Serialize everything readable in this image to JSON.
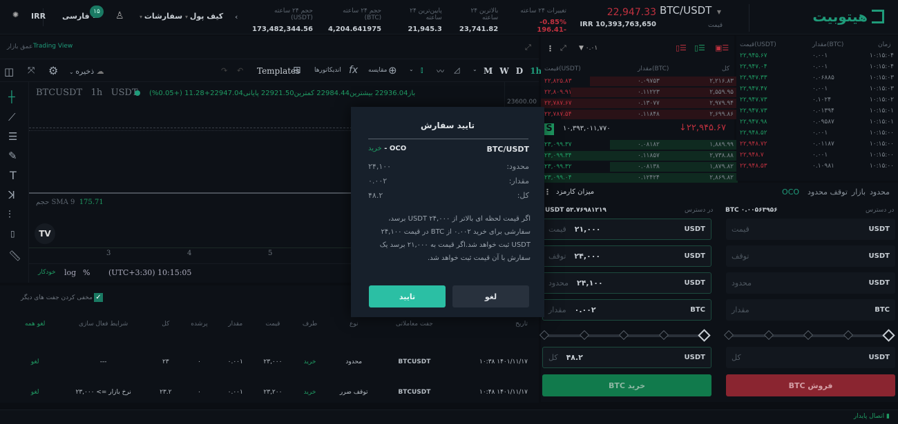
{
  "header": {
    "logo": "هیتوبیت",
    "pair": "BTC/USDT",
    "price_label": "قیمت",
    "last_price": "22,947.33",
    "irr_price": "IRR 10,393,763,650",
    "stats": [
      {
        "label": "تغییرات ۲۴ ساعته",
        "value": "-0.85%  196.41-",
        "neg": true
      },
      {
        "label": "بالاترین ۲۴ ساعته",
        "value": "23,741.82"
      },
      {
        "label": "پایین‌ترین ۲۴ ساعته",
        "value": "21,945.3"
      },
      {
        "label": "حجم ۲۴ ساعته (BTC)",
        "value": "4,204.641975"
      },
      {
        "label": "حجم ۲۴ ساعته (USDT)",
        "value": "173,482,344.56"
      }
    ],
    "wallet": "کیف پول",
    "orders": "سفارشات",
    "notif_count": "۱۵",
    "language": "فارسی",
    "currency": "IRR"
  },
  "chart": {
    "tab_depth": "عمق بازار",
    "tab_tv": "Trading View",
    "save": "ذخیره",
    "templates": "Templates",
    "indicators": "اندیکاتورها",
    "compare": "مقایسه",
    "intervals": [
      "1h",
      "D",
      "W",
      "M"
    ],
    "symbol": "BTCUSDT",
    "interval": "1h",
    "quote": "USDT",
    "ohlc": "باز22936.04  بیشترین22984.44  کمترین22921.50  پایانی22947.04+11.28 (+0.05%)",
    "price_tick": "23600.00",
    "sma_label": "حجم SMA 9",
    "sma_value": "175.71",
    "x_ticks": [
      "3",
      "4",
      "5"
    ],
    "time": "(UTC+3:30) 10:15:05",
    "pct": "%",
    "log": "log",
    "auto": "خودکار"
  },
  "open_orders": {
    "hide_others": "مخفی کردن جفت های دیگر",
    "headers": [
      "تاریخ",
      "جفت معاملاتی",
      "نوع",
      "طرف",
      "قیمت",
      "مقدار",
      "پرشده",
      "کل",
      "شرایط فعال سازی",
      "لغو همه"
    ],
    "rows": [
      [
        "۱۴۰۱/۱۱/۱۷ ۱۰:۳۸",
        "BTCUSDT",
        "محدود",
        "خرید",
        "۲۳,۰۰۰",
        "۰.۰۰۱",
        "۰",
        "۲۳",
        "---",
        "لغو"
      ],
      [
        "۱۴۰۱/۱۱/۱۷ ۱۰:۴۸",
        "BTCUSDT",
        "توقف ضرر",
        "خرید",
        "۲۳,۲۰۰",
        "۰.۰۰۱",
        "۰",
        "۲۳.۲",
        "نرخ بازار => ۲۳,۰۰۰",
        "لغو"
      ]
    ]
  },
  "orderbook": {
    "precision": "۰.۰۱",
    "headers": [
      "قیمت(USDT)",
      "مقدار(BTC)",
      "کل"
    ],
    "asks": [
      [
        "۲۲,۸۲۵.۸۳",
        "۰.۰۹۷۵۳",
        "۲,۲۱۶.۸۳"
      ],
      [
        "۲۲,۸۰۹.۹۱",
        "۰.۱۱۲۲۳",
        "۲,۵۵۹.۹۵"
      ],
      [
        "۲۲,۷۸۷.۶۷",
        "۰.۱۳۰۷۷",
        "۲,۹۷۹.۹۴"
      ],
      [
        "۲۲,۷۸۷.۵۴",
        "۰.۱۱۸۴۸",
        "۲,۶۹۹.۸۶"
      ]
    ],
    "mid_price": "↓۲۲,۹۴۵.۶۷",
    "mid_irr": "۱۰,۳۹۳,۰۱۱,۷۷۰",
    "mid_badge": "S",
    "bids": [
      [
        "۲۳,۰۹۹.۳۷",
        "۰.۰۸۱۸۲",
        "۱,۸۸۹.۹۹"
      ],
      [
        "۲۳,۰۹۹.۳۴",
        "۰.۱۱۸۵۷",
        "۲,۷۳۸.۸۸"
      ],
      [
        "۲۳,۰۹۹.۳۲",
        "۰.۰۸۱۳۸",
        "۱,۸۷۹.۸۲"
      ],
      [
        "۲۳,۰۹۹.۰۴",
        "۰.۱۲۴۲۴",
        "۲,۸۶۹.۸۲"
      ]
    ]
  },
  "trades": {
    "headers": [
      "قیمت(USDT)",
      "مقدار(BTC)",
      "زمان"
    ],
    "rows": [
      [
        "۲۲,۹۴۵.۶۷",
        "۰.۰۰۱",
        "۱۰:۱۵:۰۴",
        "g"
      ],
      [
        "۲۲,۹۴۷.۰۴",
        "۰.۰۰۱",
        "۱۰:۱۵:۰۴",
        "g"
      ],
      [
        "۲۲,۹۴۷.۳۳",
        "۰.۰۶۸۸۵",
        "۱۰:۱۵:۰۳",
        "g"
      ],
      [
        "۲۲,۹۴۷.۴۷",
        "۰.۰۰۱",
        "۱۰:۱۵:۰۳",
        "g"
      ],
      [
        "۲۲,۹۴۷.۷۳",
        "۰.۱۰۲۴",
        "۱۰:۱۵:۰۲",
        "g"
      ],
      [
        "۲۲,۹۴۷.۷۳",
        "۰.۰۱۳۹۴",
        "۱۰:۱۵:۰۱",
        "g"
      ],
      [
        "۲۲,۹۴۷.۹۸",
        "۰.۰۹۵۸۷",
        "۱۰:۱۵:۰۱",
        "g"
      ],
      [
        "۲۲,۹۴۸.۵۲",
        "۰.۰۰۱",
        "۱۰:۱۵:۰۰",
        "g"
      ],
      [
        "۲۲,۹۴۸.۷۲",
        "۰.۰۱۱۸۷",
        "۱۰:۱۵:۰۰",
        "r"
      ],
      [
        "۲۲,۹۴۸.۷",
        "۰.۰۰۱",
        "۱۰:۱۵:۰۰",
        "r"
      ],
      [
        "۲۲,۹۴۸.۵۳",
        "۰.۱۰۹۸۱",
        "۱۰:۱۵:۰۰",
        "r"
      ]
    ]
  },
  "form": {
    "tabs": [
      "محدود",
      "بازار",
      "توقف محدود",
      "OCO"
    ],
    "fee": "میزان کارمزد",
    "available": "در دسترس",
    "sell_avail": "BTC ۰.۰۰۵۶۳۹۵۶",
    "buy_avail": "USDT ۵۳.۷۶۹۸۱۲۱۹",
    "ph": {
      "price": "قیمت",
      "stop": "توقف",
      "limit": "محدود",
      "amount": "مقدار",
      "total": "کل"
    },
    "buy": {
      "price": "۲۱,۰۰۰",
      "stop": "۲۴,۰۰۰",
      "limit": "۲۴,۱۰۰",
      "amount": "۰.۰۰۲",
      "total": "۴۸.۲",
      "button": "خرید BTC"
    },
    "sell_button": "فروش BTC",
    "usdt": "USDT",
    "btc": "BTC"
  },
  "modal": {
    "title": "تایید سفارش",
    "pair": "BTC/USDT",
    "type": "OCO - ",
    "side": "خرید",
    "limit_label": "محدود:",
    "limit": "۲۴,۱۰۰",
    "amount_label": "مقدار:",
    "amount": "۰.۰۰۲",
    "total_label": "کل:",
    "total": "۴۸.۲",
    "desc": "اگر قیمت لحظه ای بالاتر از ۲۴,۰۰۰ USDT برسد، سفارشی برای خرید ۰.۰۰۲ از BTC در قیمت ۲۴,۱۰۰ USDT ثبت خواهد شد.اگر قیمت به ۲۱,۰۰۰ برسد یک سفارش با آن قیمت ثبت خواهد شد.",
    "confirm": "تایید",
    "cancel": "لغو"
  },
  "status": {
    "connection": "اتصال پایدار"
  }
}
